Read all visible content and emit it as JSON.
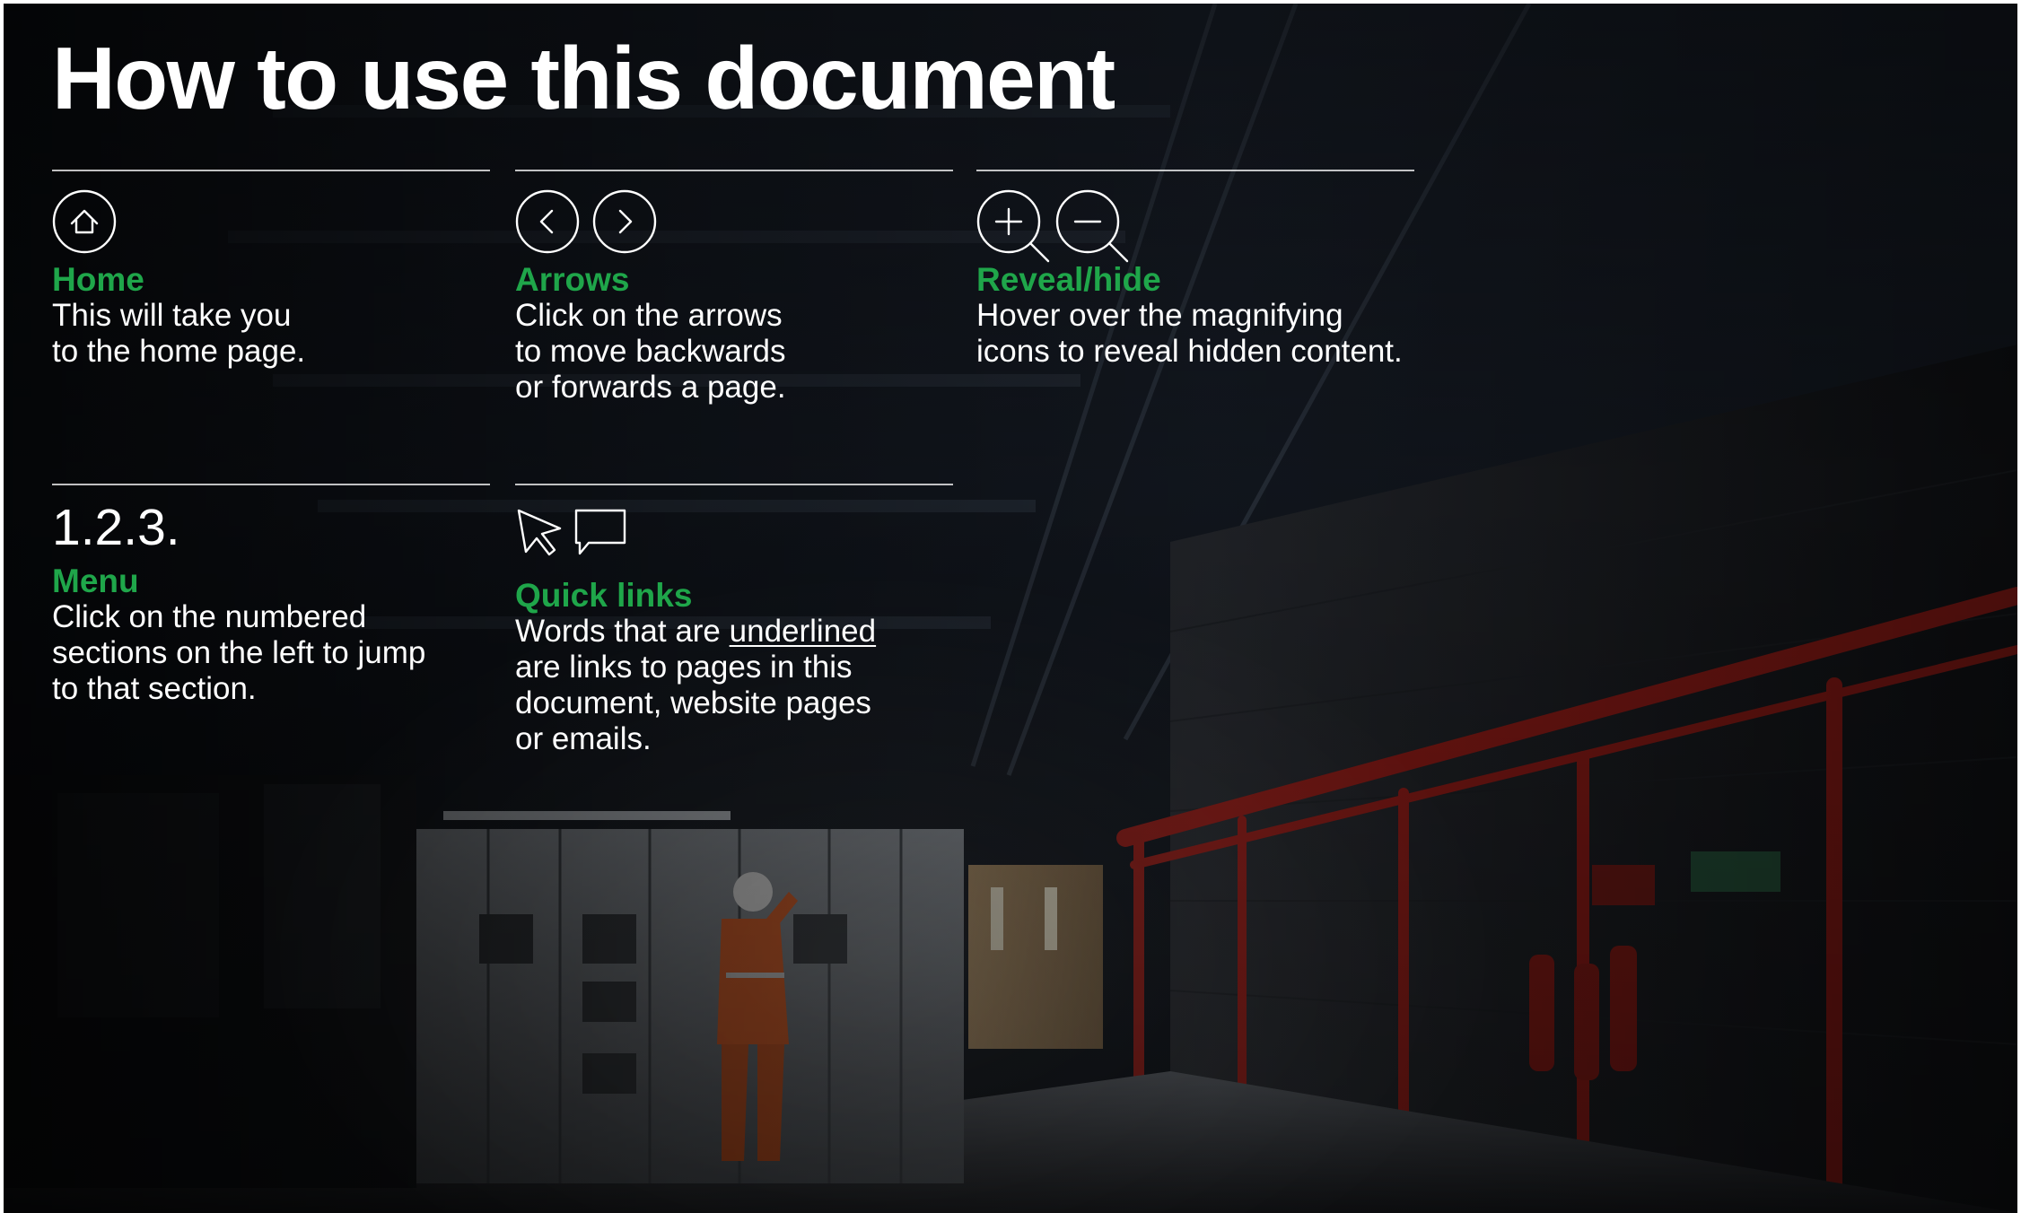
{
  "page": {
    "title": "How to use this document"
  },
  "colors": {
    "accent_green": "#1fa64a",
    "text": "#ffffff",
    "background": "#0a0c10"
  },
  "sections": {
    "home": {
      "icon": "home-icon",
      "label": "Home",
      "lines": [
        "This will take you",
        "to the home page."
      ]
    },
    "arrows": {
      "icons": [
        "arrow-left-icon",
        "arrow-right-icon"
      ],
      "label": "Arrows",
      "lines": [
        "Click on the arrows",
        "to move backwards",
        "or forwards a page."
      ]
    },
    "reveal": {
      "icons": [
        "magnify-plus-icon",
        "magnify-minus-icon"
      ],
      "label": "Reveal/hide",
      "lines": [
        "Hover over the magnifying",
        "icons to reveal hidden content."
      ]
    },
    "menu": {
      "numbered": "1.2.3.",
      "label": "Menu",
      "lines": [
        "Click on the numbered",
        "sections on the left to jump",
        "to that section."
      ]
    },
    "quicklinks": {
      "icons": [
        "cursor-arrow-icon",
        "speech-bubble-icon"
      ],
      "label": "Quick links",
      "line1_prefix": "Words that are ",
      "line1_link": "underlined",
      "lines": [
        "are links to pages in this",
        "document, website pages",
        "or emails."
      ]
    }
  }
}
